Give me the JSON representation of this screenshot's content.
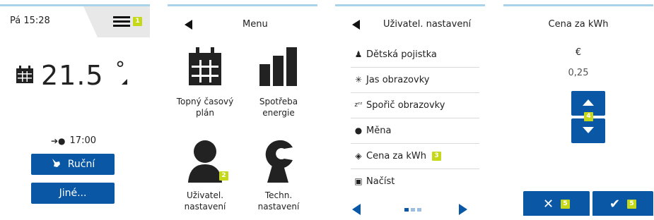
{
  "screen1": {
    "clock": "Pá 15:28",
    "badge": "1",
    "temperature": "21.5",
    "degree": "°",
    "next_time": "17:00",
    "manual_label": "Ruční",
    "other_label": "Jiné..."
  },
  "screen2": {
    "title": "Menu",
    "items": [
      {
        "label": "Topný časový plán",
        "icon": "calendar-icon"
      },
      {
        "label": "Spotřeba energie",
        "icon": "bar-chart-icon"
      },
      {
        "label": "Uživatel. nastavení",
        "icon": "user-icon",
        "badge": "2"
      },
      {
        "label": "Techn. nastavení",
        "icon": "wrench-icon"
      }
    ]
  },
  "screen3": {
    "title": "Uživatel. nastavení",
    "items": [
      {
        "label": "Dětská pojistka",
        "icon": "child-lock-icon"
      },
      {
        "label": "Jas obrazovky",
        "icon": "brightness-icon"
      },
      {
        "label": "Spořič obrazovky",
        "icon": "sleep-icon"
      },
      {
        "label": "Měna",
        "icon": "currency-icon"
      },
      {
        "label": "Cena za kWh",
        "icon": "tag-icon",
        "badge": "3"
      },
      {
        "label": "Načíst",
        "icon": "load-icon"
      }
    ]
  },
  "screen4": {
    "title": "Cena za kWh",
    "currency": "€",
    "value": "0,25",
    "stepper_badge": "4",
    "cancel_badge": "5",
    "confirm_badge": "5"
  }
}
